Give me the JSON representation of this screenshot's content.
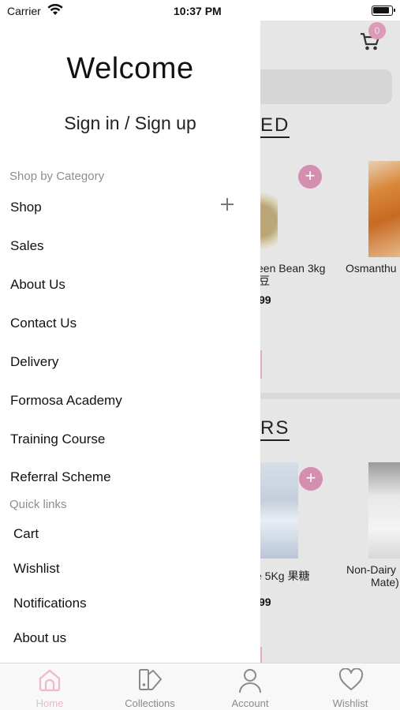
{
  "status_bar": {
    "carrier": "Carrier",
    "time": "10:37 PM"
  },
  "drawer": {
    "welcome": "Welcome",
    "sign_in": "Sign in / Sign up",
    "category_heading": "Shop by Category",
    "menu": [
      "Shop",
      "Sales",
      "About Us",
      "Contact Us",
      "Delivery",
      "Formosa Academy",
      "Training Course",
      "Referral Scheme"
    ],
    "quick_links_heading": "Quick links",
    "quick_links": [
      "Cart",
      "Wishlist",
      "Notifications",
      "About us"
    ]
  },
  "background": {
    "cart_count": "0",
    "section1_title": "ED",
    "section2_title": "RS",
    "products": [
      {
        "name_line1": "een Bean 3kg",
        "name_line2": "豆",
        "price": "99"
      },
      {
        "name_line1": "Osmanthu",
        "name_line2": "",
        "price": ""
      },
      {
        "name_line1": "e 5Kg 果糖",
        "name_line2": "",
        "price": "99"
      },
      {
        "name_line1": "Non-Dairy",
        "name_line2": "Mate)",
        "price": ""
      }
    ]
  },
  "tabbar": {
    "tabs": [
      {
        "label": "Home",
        "icon": "home-icon",
        "active": true
      },
      {
        "label": "Collections",
        "icon": "collections-icon",
        "active": false
      },
      {
        "label": "Account",
        "icon": "account-icon",
        "active": false
      },
      {
        "label": "Wishlist",
        "icon": "heart-icon",
        "active": false
      }
    ]
  },
  "colors": {
    "accent_pink": "#f0b7cf",
    "bubble_pink": "#d48fb0",
    "muted_text": "#8e8e8e"
  }
}
